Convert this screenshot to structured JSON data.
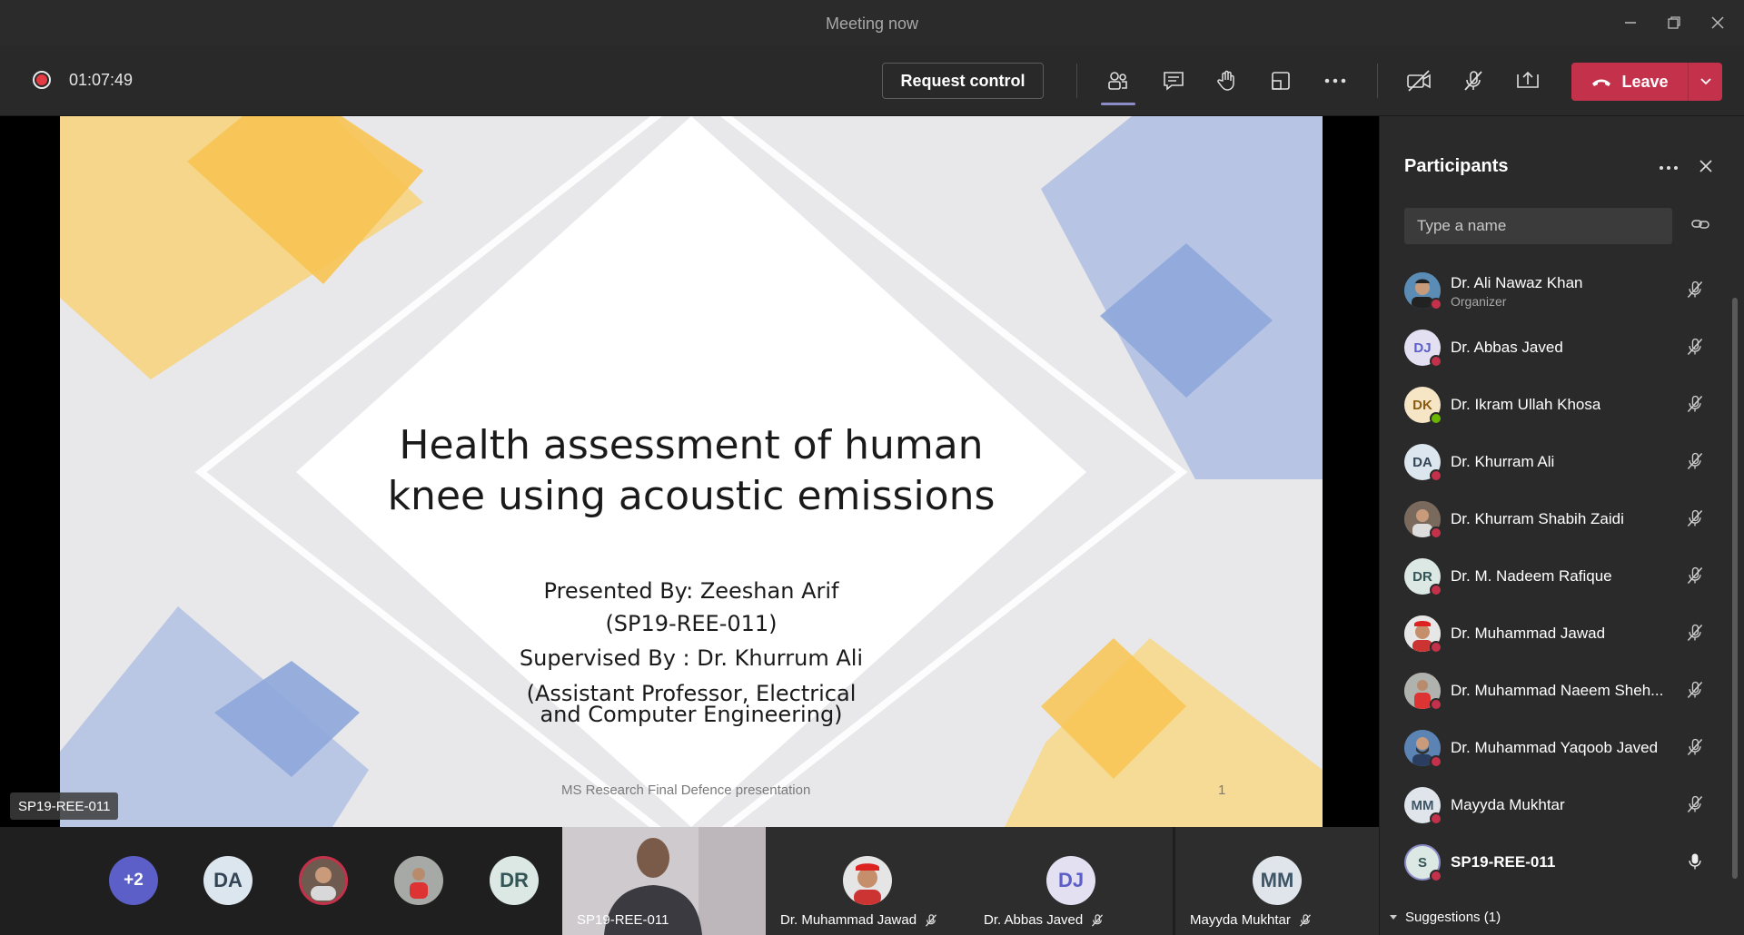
{
  "window": {
    "title": "Meeting now"
  },
  "toolbar": {
    "timer": "01:07:49",
    "request_control": "Request control",
    "leave_label": "Leave"
  },
  "slide": {
    "title_line1": "Health assessment of human",
    "title_line2": "knee using acoustic emissions",
    "presented_by": "Presented By: Zeeshan Arif",
    "student_id": "(SP19-REE-011)",
    "supervised_by": "Supervised By : Dr. Khurrum Ali",
    "affiliation_line1": "(Assistant Professor, Electrical",
    "affiliation_line2": "and Computer Engineering)",
    "footer": "MS Research Final Defence presentation",
    "page_number": "1",
    "presenter_label": "SP19-REE-011"
  },
  "gallery": {
    "overflow_count": "+2",
    "avatars": [
      {
        "initials": "DA"
      },
      {
        "initials": "DR"
      }
    ],
    "tiles": [
      {
        "name": "SP19-REE-011"
      },
      {
        "name": "Dr. Muhammad Jawad"
      },
      {
        "name": "Dr. Abbas Javed",
        "initials": "DJ"
      },
      {
        "name": "Mayyda Mukhtar",
        "initials": "MM"
      }
    ]
  },
  "participants": {
    "title": "Participants",
    "search_placeholder": "Type a name",
    "list": [
      {
        "name": "Dr. Ali Nawaz Khan",
        "role": "Organizer",
        "initials": ""
      },
      {
        "name": "Dr. Abbas Javed",
        "initials": "DJ"
      },
      {
        "name": "Dr. Ikram Ullah Khosa",
        "initials": "DK"
      },
      {
        "name": "Dr. Khurram Ali",
        "initials": "DA"
      },
      {
        "name": "Dr. Khurram Shabih Zaidi",
        "initials": ""
      },
      {
        "name": "Dr. M. Nadeem Rafique",
        "initials": "DR"
      },
      {
        "name": "Dr. Muhammad Jawad",
        "initials": ""
      },
      {
        "name": "Dr. Muhammad Naeem Sheh...",
        "initials": ""
      },
      {
        "name": "Dr. Muhammad Yaqoob Javed",
        "initials": ""
      },
      {
        "name": "Mayyda Mukhtar",
        "initials": "MM"
      },
      {
        "name": "SP19-REE-011",
        "initials": "S"
      }
    ],
    "suggestions": "Suggestions (1)"
  },
  "colors": {
    "leave": "#c4314b",
    "accent": "#8b8cc7",
    "slide_yellow": "#f7c44c",
    "slide_blue": "#8fa8d8"
  }
}
